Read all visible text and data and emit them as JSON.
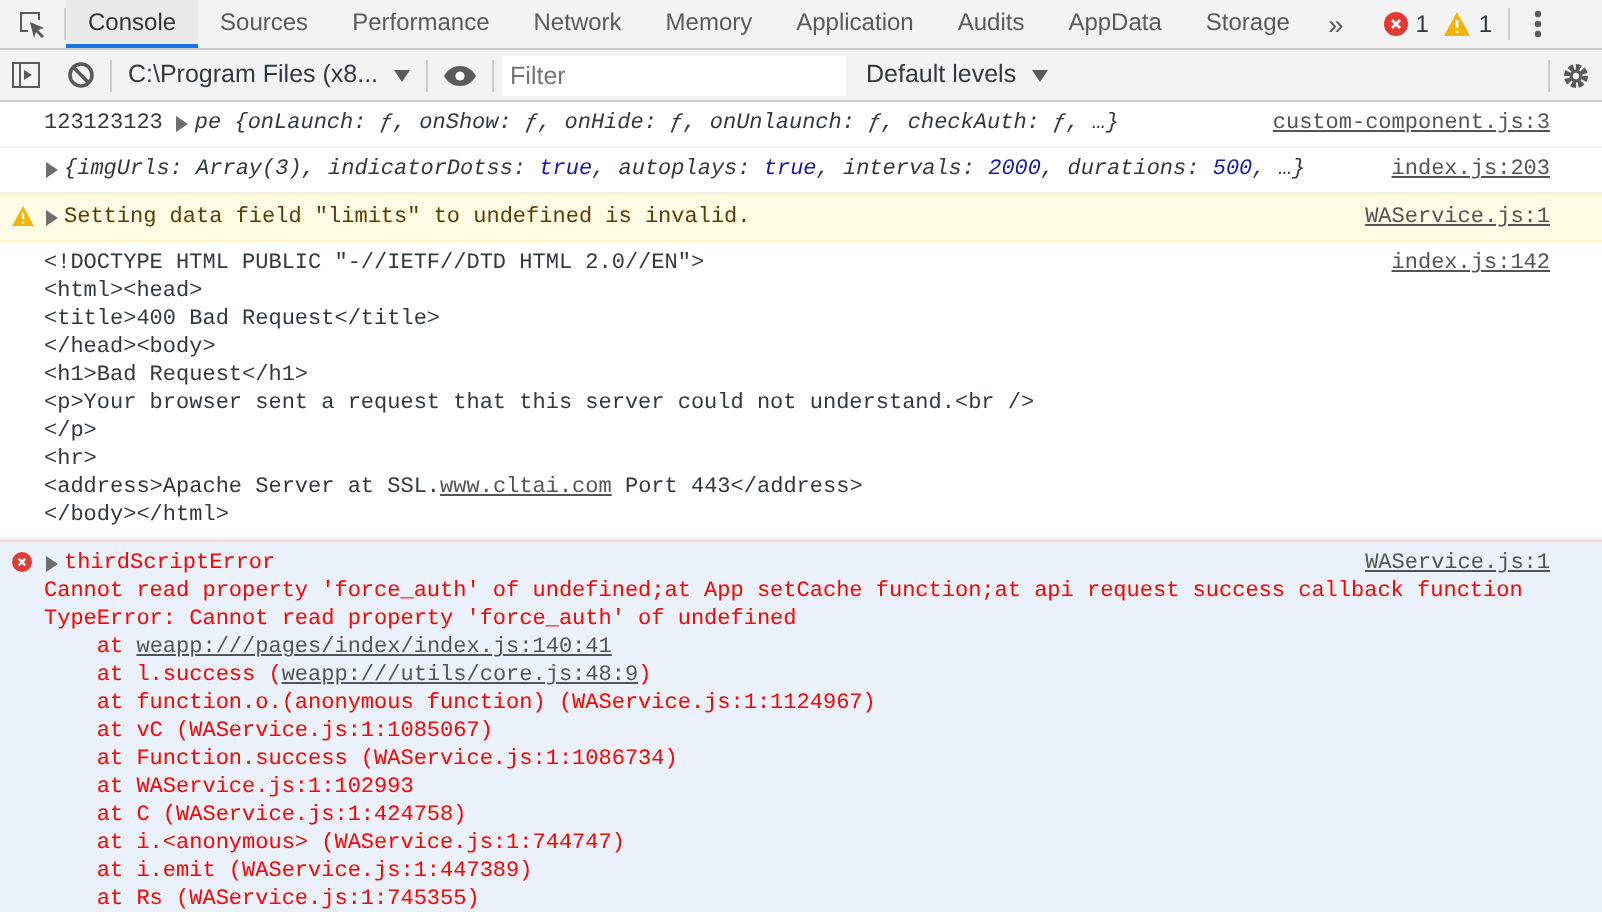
{
  "tabs": [
    {
      "label": "Console",
      "selected": true
    },
    {
      "label": "Sources",
      "selected": false
    },
    {
      "label": "Performance",
      "selected": false
    },
    {
      "label": "Network",
      "selected": false
    },
    {
      "label": "Memory",
      "selected": false
    },
    {
      "label": "Application",
      "selected": false
    },
    {
      "label": "Audits",
      "selected": false
    },
    {
      "label": "AppData",
      "selected": false
    },
    {
      "label": "Storage",
      "selected": false
    }
  ],
  "more_tabs": "»",
  "error_count": "1",
  "warning_count": "1",
  "toolbar": {
    "context": "C:\\Program Files (x8...",
    "filter": {
      "placeholder": "Filter"
    },
    "levels": "Default levels"
  },
  "messages": [
    {
      "kind": "log",
      "prefix": "123123123",
      "expandable": true,
      "parts": [
        {
          "text": "pe {onLaunch: ƒ, onShow: ƒ, onHide: ƒ, onUnlaunch: ƒ, checkAuth: ƒ, …}",
          "kind": "plain"
        }
      ],
      "italic": true,
      "source": "custom-component.js:3"
    },
    {
      "kind": "log",
      "expandable": true,
      "parts": [
        {
          "text": "{imgUrls: Array(3), indicatorDotss: ",
          "kind": "plain"
        },
        {
          "text": "true",
          "kind": "value"
        },
        {
          "text": ", autoplays: ",
          "kind": "plain"
        },
        {
          "text": "true",
          "kind": "value"
        },
        {
          "text": ", intervals: ",
          "kind": "plain"
        },
        {
          "text": "2000",
          "kind": "value"
        },
        {
          "text": ", durations: ",
          "kind": "plain"
        },
        {
          "text": "500",
          "kind": "value"
        },
        {
          "text": ", …}",
          "kind": "plain"
        }
      ],
      "italic": true,
      "source": "index.js:203"
    },
    {
      "kind": "warning",
      "expandable": true,
      "parts": [
        {
          "text": "Setting data field \"limits\" to undefined is invalid.",
          "kind": "plain"
        }
      ],
      "italic": false,
      "source": "WAService.js:1"
    },
    {
      "kind": "log",
      "expandable": false,
      "lines": [
        [
          {
            "text": "<!DOCTYPE HTML PUBLIC \"-//IETF//DTD HTML 2.0//EN\">",
            "link": false
          }
        ],
        [
          {
            "text": "<html><head>",
            "link": false
          }
        ],
        [
          {
            "text": "<title>400 Bad Request</title>",
            "link": false
          }
        ],
        [
          {
            "text": "</head><body>",
            "link": false
          }
        ],
        [
          {
            "text": "<h1>Bad Request</h1>",
            "link": false
          }
        ],
        [
          {
            "text": "<p>Your browser sent a request that this server could not understand.<br />",
            "link": false
          }
        ],
        [
          {
            "text": "</p>",
            "link": false
          }
        ],
        [
          {
            "text": "<hr>",
            "link": false
          }
        ],
        [
          {
            "text": "<address>Apache Server at SSL.",
            "link": false
          },
          {
            "text": "www.cltai.com",
            "link": true
          },
          {
            "text": " Port 443</address>",
            "link": false
          }
        ],
        [
          {
            "text": "</body></html>",
            "link": false
          }
        ]
      ],
      "source": "index.js:142"
    },
    {
      "kind": "error",
      "expandable": true,
      "parts": [
        {
          "text": "thirdScriptError",
          "kind": "plain"
        }
      ],
      "italic": false,
      "source": "WAService.js:1",
      "lines": [
        [
          {
            "text": "Cannot read property 'force_auth' of undefined;at App setCache function;at api request success callback function",
            "link": false
          }
        ],
        [
          {
            "text": "TypeError: Cannot read property 'force_auth' of undefined",
            "link": false
          }
        ],
        [
          {
            "text": "    at ",
            "link": false
          },
          {
            "text": "weapp:///pages/index/index.js:140:41",
            "link": true
          }
        ],
        [
          {
            "text": "    at l.success (",
            "link": false
          },
          {
            "text": "weapp:///utils/core.js:48:9",
            "link": true
          },
          {
            "text": ")",
            "link": false
          }
        ],
        [
          {
            "text": "    at function.o.(anonymous function) (WAService.js:1:1124967)",
            "link": false
          }
        ],
        [
          {
            "text": "    at vC (WAService.js:1:1085067)",
            "link": false
          }
        ],
        [
          {
            "text": "    at Function.success (WAService.js:1:1086734)",
            "link": false
          }
        ],
        [
          {
            "text": "    at WAService.js:1:102993",
            "link": false
          }
        ],
        [
          {
            "text": "    at C (WAService.js:1:424758)",
            "link": false
          }
        ],
        [
          {
            "text": "    at i.<anonymous> (WAService.js:1:744747)",
            "link": false
          }
        ],
        [
          {
            "text": "    at i.emit (WAService.js:1:447389)",
            "link": false
          }
        ],
        [
          {
            "text": "    at Rs (WAService.js:1:745355)",
            "link": false
          }
        ]
      ]
    }
  ]
}
